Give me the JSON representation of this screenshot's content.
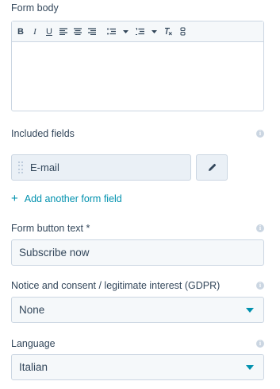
{
  "form_body": {
    "label": "Form body",
    "toolbar": {
      "bold": "B",
      "italic": "I",
      "underline": "U"
    }
  },
  "included_fields": {
    "label": "Included fields",
    "fields": [
      {
        "label": "E-mail"
      }
    ],
    "add_link": "Add another form field"
  },
  "button_text": {
    "label": "Form button text *",
    "value": "Subscribe now"
  },
  "gdpr": {
    "label": "Notice and consent / legitimate interest (GDPR)",
    "selected": "None"
  },
  "language": {
    "label": "Language",
    "selected": "Italian"
  },
  "colors": {
    "text": "#33475b",
    "accent": "#0091ae",
    "border": "#cbd6e2",
    "input_bg": "#f5f8fa",
    "chip_bg": "#eaf0f6",
    "info_icon": "#cbd6e2"
  },
  "icons": {
    "info": "info-icon",
    "edit": "pencil-icon",
    "add": "plus-icon",
    "drag": "drag-handle-icon",
    "dropdown": "caret-down-icon"
  }
}
